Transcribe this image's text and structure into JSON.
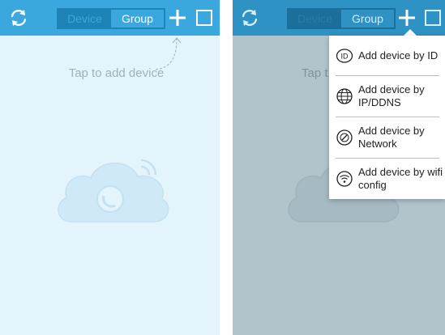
{
  "left": {
    "tabs": {
      "device": "Device",
      "group": "Group"
    },
    "empty_hint": "Tap to add device"
  },
  "right": {
    "tabs": {
      "device": "Device",
      "group": "Group"
    },
    "empty_hint": "Tap t",
    "menu": [
      {
        "label": "Add device by ID",
        "icon": "id-icon"
      },
      {
        "label": "Add device by IP/DDNS",
        "icon": "globe-icon"
      },
      {
        "label": "Add device by Network",
        "icon": "network-icon"
      },
      {
        "label": "Add device by wifi config",
        "icon": "wifi-icon"
      }
    ]
  },
  "colors": {
    "header": "#3aa8de",
    "segment_active": "#1e84b8",
    "content_bg": "#e4f4fc",
    "content_dimmed": "#b1c4cc",
    "hint_text": "#9fb1ba"
  }
}
